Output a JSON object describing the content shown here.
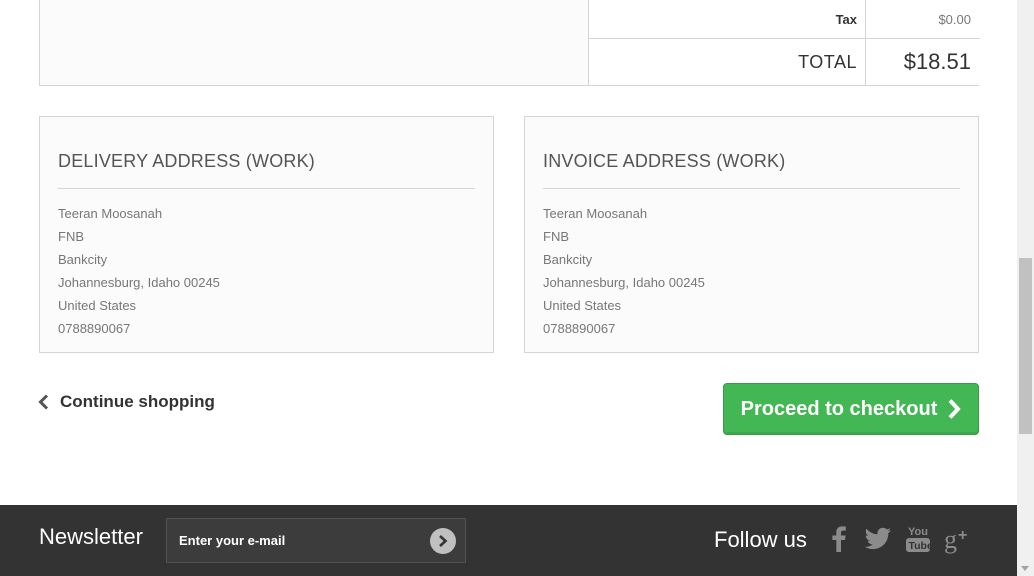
{
  "summary": {
    "tax_label": "Tax",
    "tax_value": "$0.00",
    "total_label": "TOTAL",
    "total_value": "$18.51"
  },
  "delivery": {
    "title": "DELIVERY ADDRESS (WORK)",
    "lines": [
      "Teeran Moosanah",
      "FNB",
      "Bankcity",
      "Johannesburg, Idaho 00245",
      "United States",
      "0788890067"
    ]
  },
  "invoice": {
    "title": "INVOICE ADDRESS (WORK)",
    "lines": [
      "Teeran Moosanah",
      "FNB",
      "Bankcity",
      "Johannesburg, Idaho 00245",
      "United States",
      "0788890067"
    ]
  },
  "actions": {
    "continue_label": "Continue shopping",
    "checkout_label": "Proceed to checkout"
  },
  "footer": {
    "newsletter_title": "Newsletter",
    "newsletter_placeholder": "Enter your e-mail",
    "follow_title": "Follow us",
    "social_icons": [
      "facebook-icon",
      "twitter-icon",
      "youtube-icon",
      "google-plus-icon"
    ]
  },
  "colors": {
    "checkout_green": "#43b754",
    "footer_bg": "#333333"
  }
}
